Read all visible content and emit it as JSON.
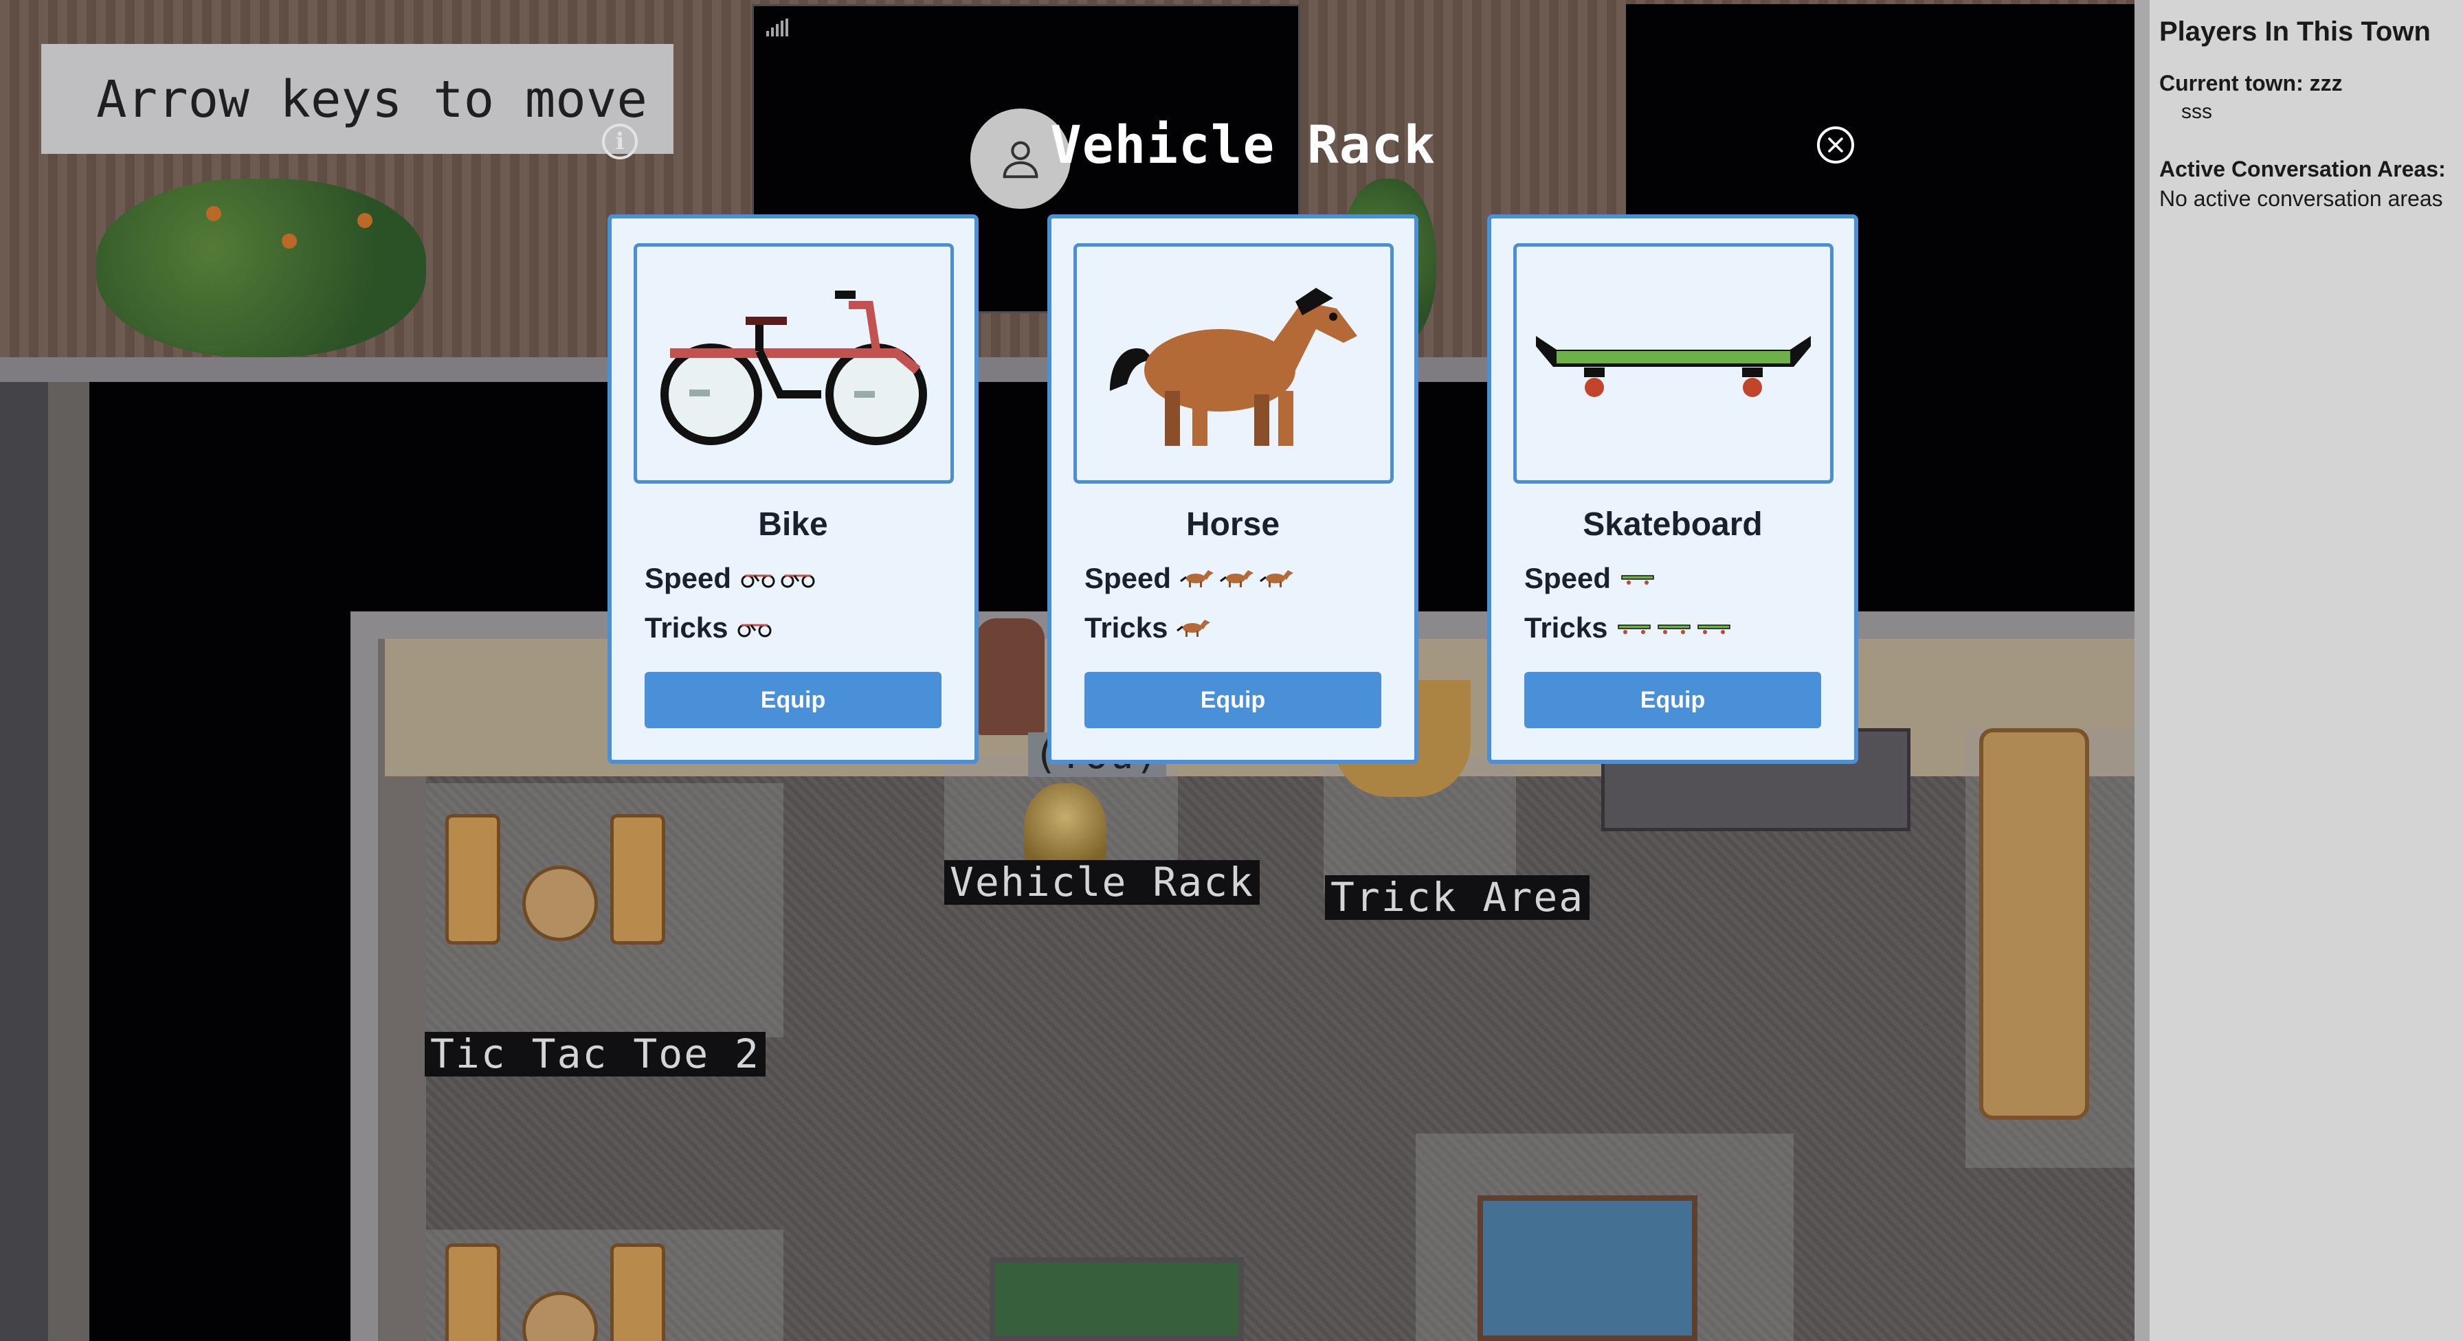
{
  "game": {
    "help_text": "Arrow keys to move",
    "info_icon": "info-icon",
    "labels": {
      "tic_tac_toe": "Tic Tac Toe 2",
      "vehicle_rack": "Vehicle Rack",
      "trick_area": "Trick Area",
      "you": "(You)"
    }
  },
  "modal": {
    "title": "Vehicle Rack",
    "close_icon": "close-circle-icon",
    "avatar_icon": "user-avatar-icon",
    "speed_label": "Speed",
    "tricks_label": "Tricks",
    "vehicles": [
      {
        "name": "Bike",
        "icon": "bike-icon",
        "speed": 2,
        "tricks": 1,
        "button": "Equip"
      },
      {
        "name": "Horse",
        "icon": "horse-icon",
        "speed": 3,
        "tricks": 1,
        "button": "Equip"
      },
      {
        "name": "Skateboard",
        "icon": "skateboard-icon",
        "speed": 1,
        "tricks": 3,
        "button": "Equip"
      }
    ]
  },
  "sidebar": {
    "title": "Players In This Town",
    "current_town": "Current town: zzz",
    "players": [
      "sss"
    ],
    "areas_title": "Active Conversation Areas:",
    "areas_empty": "No active conversation areas"
  },
  "colors": {
    "accent": "#4a90d9",
    "card_bg": "#ebf4fd",
    "sidebar_bg": "#d4d4d4"
  }
}
